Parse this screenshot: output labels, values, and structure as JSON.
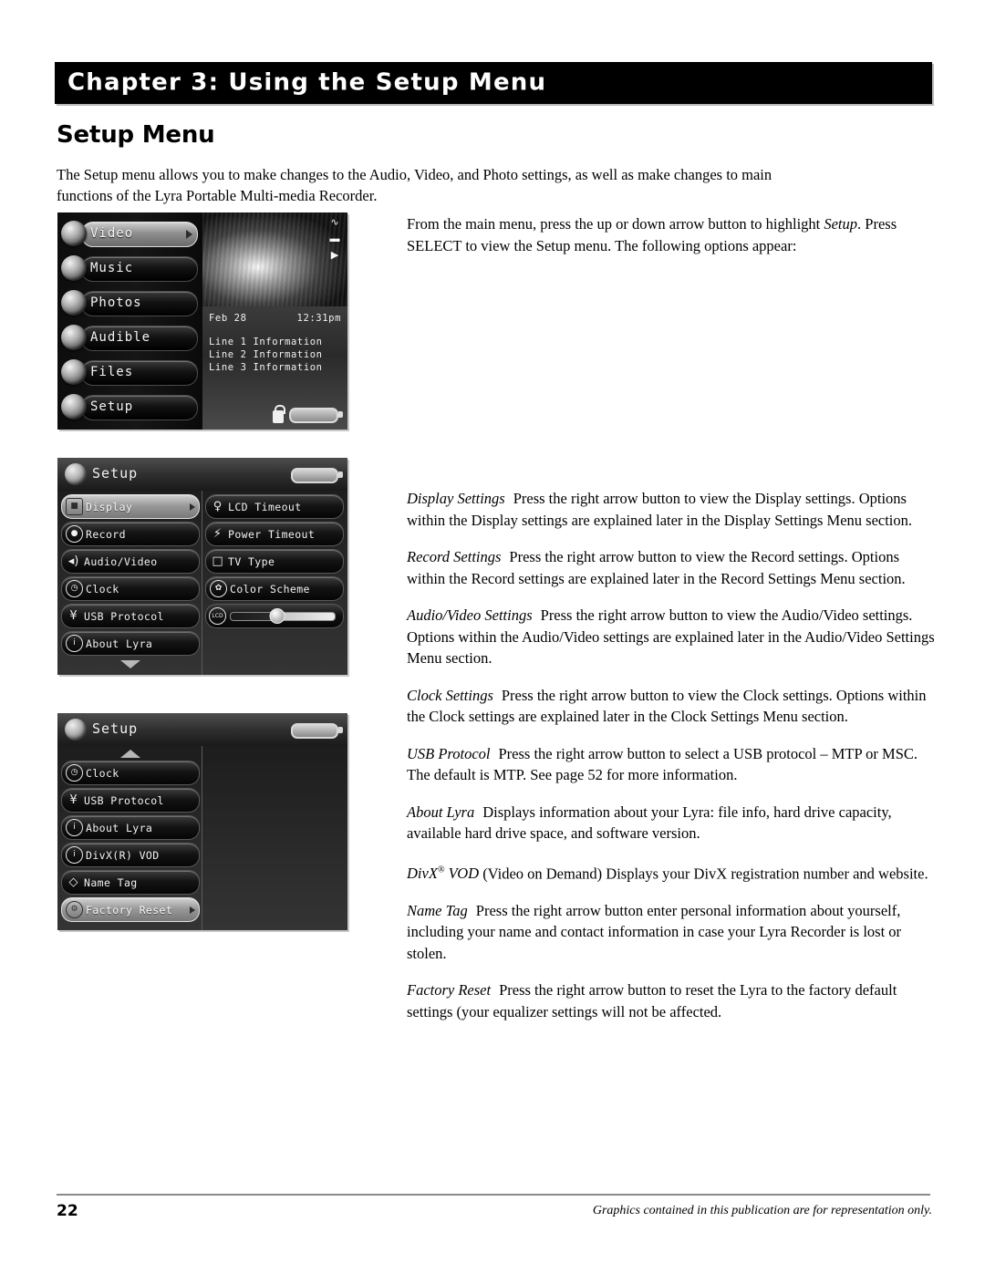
{
  "header": {
    "chapter_title": "Chapter 3: Using the Setup Menu"
  },
  "section": {
    "heading": "Setup Menu",
    "intro": "The Setup menu allows you to make changes to the Audio, Video, and Photo settings, as well as make changes to main functions of the Lyra Portable Multi-media Recorder."
  },
  "body": {
    "paragraphs": [
      {
        "term": "",
        "text": "From the main menu, press the up or down arrow button to highlight Setup. Press SELECT to view the Setup menu. The following options appear:"
      },
      {
        "term": "Display Settings",
        "text": "Press the right arrow button to view the Display settings. Options within the Display settings are explained later in the Display Settings Menu section."
      },
      {
        "term": "Record Settings",
        "text": "Press the right arrow button to view the Record settings. Options within the Record settings are explained later in the Record Settings Menu section."
      },
      {
        "term": "Audio/Video Settings",
        "text": "Press the right arrow button to view the Audio/Video settings. Options within the Audio/Video settings are explained later in the Audio/Video Settings Menu section."
      },
      {
        "term": "Clock Settings",
        "text": "Press the right arrow button to view the Clock settings. Options within the Clock settings are explained later in the Clock Settings Menu section."
      },
      {
        "term": "USB Protocol",
        "text": "Press the right arrow button to select a USB protocol – MTP or MSC. The default is MTP. See page 52 for more information."
      },
      {
        "term": "About Lyra",
        "text": "Displays information about your Lyra: file info, hard drive capacity, available hard drive space, and software version."
      },
      {
        "term": "DivX VOD",
        "text": "(Video on Demand)   Displays your DivX registration number and website."
      },
      {
        "term": "Name Tag",
        "text": "Press the right arrow button enter personal information about yourself, including your name and contact information in case your Lyra Recorder is lost or stolen."
      },
      {
        "term": "Factory Reset",
        "text": "Press the right arrow button to reset the Lyra to the factory default settings (your equalizer settings will not be affected."
      }
    ]
  },
  "screenshots": {
    "main_menu": {
      "items": [
        {
          "label": "Video",
          "icon": "camcorder-icon",
          "selected": true
        },
        {
          "label": "Music",
          "icon": "headphones-icon",
          "selected": false
        },
        {
          "label": "Photos",
          "icon": "camera-icon",
          "selected": false
        },
        {
          "label": "Audible",
          "icon": "speaker-icon",
          "selected": false
        },
        {
          "label": "Files",
          "icon": "folder-icon",
          "selected": false
        },
        {
          "label": "Setup",
          "icon": "gear-icon",
          "selected": false
        }
      ],
      "info": {
        "date": "Feb 28",
        "time": "12:31pm",
        "lines": [
          "Line 1 Information",
          "Line 2 Information",
          "Line 3 Information"
        ]
      }
    },
    "setup_page_1": {
      "title": "Setup",
      "left_items": [
        {
          "label": "Display",
          "icon": "display-icon",
          "glyph": "■",
          "shape": "sq",
          "selected": true
        },
        {
          "label": "Record",
          "icon": "record-icon",
          "glyph": "●",
          "shape": "",
          "selected": false
        },
        {
          "label": "Audio/Video",
          "icon": "speaker-icon",
          "glyph": "◂)",
          "shape": "nb",
          "selected": false
        },
        {
          "label": "Clock",
          "icon": "clock-icon",
          "glyph": "◷",
          "shape": "",
          "selected": false
        },
        {
          "label": "USB Protocol",
          "icon": "usb-icon",
          "glyph": "¥",
          "shape": "nb",
          "selected": false
        },
        {
          "label": "About Lyra",
          "icon": "info-icon",
          "glyph": "i",
          "shape": "",
          "selected": false
        }
      ],
      "right_items": [
        {
          "label": "LCD Timeout",
          "icon": "lightbulb-icon",
          "glyph": "♀",
          "shape": "nb",
          "selected": false
        },
        {
          "label": "Power Timeout",
          "icon": "lightning-icon",
          "glyph": "⚡",
          "shape": "nb",
          "selected": false
        },
        {
          "label": "TV Type",
          "icon": "television-icon",
          "glyph": "□",
          "shape": "nb",
          "selected": false
        },
        {
          "label": "Color Scheme",
          "icon": "palette-icon",
          "glyph": "✿",
          "shape": "",
          "selected": false
        }
      ],
      "brightness_slider": {
        "icon": "lcd-icon",
        "glyph": "LCD",
        "value": 52
      },
      "scroll_indicator": "down-arrow-icon"
    },
    "setup_page_2": {
      "title": "Setup",
      "left_items": [
        {
          "label": "Clock",
          "icon": "clock-icon",
          "glyph": "◷",
          "shape": "",
          "selected": false
        },
        {
          "label": "USB Protocol",
          "icon": "usb-icon",
          "glyph": "¥",
          "shape": "nb",
          "selected": false
        },
        {
          "label": "About Lyra",
          "icon": "info-icon",
          "glyph": "i",
          "shape": "",
          "selected": false
        },
        {
          "label": "DivX(R) VOD",
          "icon": "info-icon",
          "glyph": "i",
          "shape": "",
          "selected": false
        },
        {
          "label": "Name Tag",
          "icon": "tag-icon",
          "glyph": "◇",
          "shape": "nb",
          "selected": false
        },
        {
          "label": "Factory Reset",
          "icon": "gear-icon",
          "glyph": "⚙",
          "shape": "",
          "selected": true
        }
      ],
      "scroll_indicator": "up-arrow-icon"
    }
  },
  "footer": {
    "page_number": "22",
    "note": "Graphics contained in this publication are for representation only."
  }
}
